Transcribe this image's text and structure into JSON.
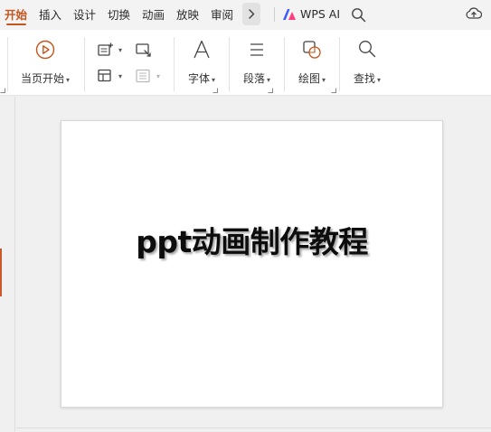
{
  "menu": {
    "tabs": [
      {
        "label": "开始",
        "active": true
      },
      {
        "label": "插入",
        "active": false
      },
      {
        "label": "设计",
        "active": false
      },
      {
        "label": "切换",
        "active": false
      },
      {
        "label": "动画",
        "active": false
      },
      {
        "label": "放映",
        "active": false
      },
      {
        "label": "审阅",
        "active": false
      }
    ],
    "more_icon": "chevron-right-icon",
    "ai_label": "WPS AI",
    "search_icon": "search-icon",
    "cloud_icon": "cloud-upload-icon"
  },
  "ribbon": {
    "play_from_current": {
      "label": "当页开始",
      "icon": "play-circle-icon"
    },
    "new_slide_icon": "new-slide-icon",
    "layout_icon": "layout-icon",
    "reset_icon": "reset-slide-icon",
    "section_icon": "section-icon",
    "font": {
      "label": "字体",
      "icon": "font-a-icon"
    },
    "paragraph": {
      "label": "段落",
      "icon": "paragraph-lines-icon"
    },
    "drawing": {
      "label": "绘图",
      "icon": "shapes-icon"
    },
    "find": {
      "label": "查找",
      "icon": "magnifier-icon"
    }
  },
  "slide": {
    "title": "ppt动画制作教程"
  },
  "colors": {
    "accent": "#c4561d",
    "wps_ai_blue": "#3d5afe",
    "wps_ai_pink": "#ff3d7f"
  }
}
